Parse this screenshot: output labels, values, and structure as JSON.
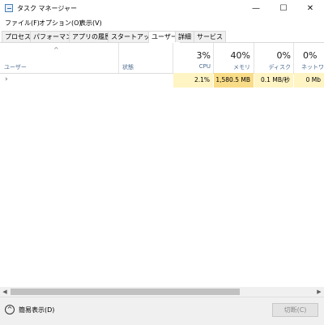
{
  "window": {
    "title": "タスク マネージャー",
    "minimize_glyph": "—",
    "maximize_glyph": "☐",
    "close_glyph": "✕"
  },
  "menu": [
    "ファイル(F)",
    "オプション(O)",
    "表示(V)"
  ],
  "tabs": [
    "プロセス",
    "パフォーマンス",
    "アプリの履歴",
    "スタートアップ",
    "ユーザー",
    "詳細",
    "サービス"
  ],
  "active_tab": "ユーザー",
  "columns": {
    "user": {
      "label": "ユーザー",
      "sort_glyph": "^"
    },
    "status": {
      "label": "状態"
    },
    "cpu": {
      "percent": "3%",
      "label": "CPU"
    },
    "memory": {
      "percent": "40%",
      "label": "メモリ"
    },
    "disk": {
      "percent": "0%",
      "label": "ディスク"
    },
    "network": {
      "percent": "0%",
      "label": "ネットワーク"
    }
  },
  "rows": [
    {
      "expand_glyph": "›",
      "user": "",
      "status": "",
      "cpu": "2.1%",
      "memory": "1,580.5 MB",
      "disk": "0.1 MB/秒",
      "network": "0 Mb"
    }
  ],
  "footer": {
    "simple_view": "簡易表示(D)",
    "end_task": "切断(C)"
  },
  "colors": {
    "cpu_cell": "#fff4c4",
    "memory_cell": "#f9dc88",
    "disk_cell": "#fff4c4",
    "network_cell": "#fff4c4"
  }
}
